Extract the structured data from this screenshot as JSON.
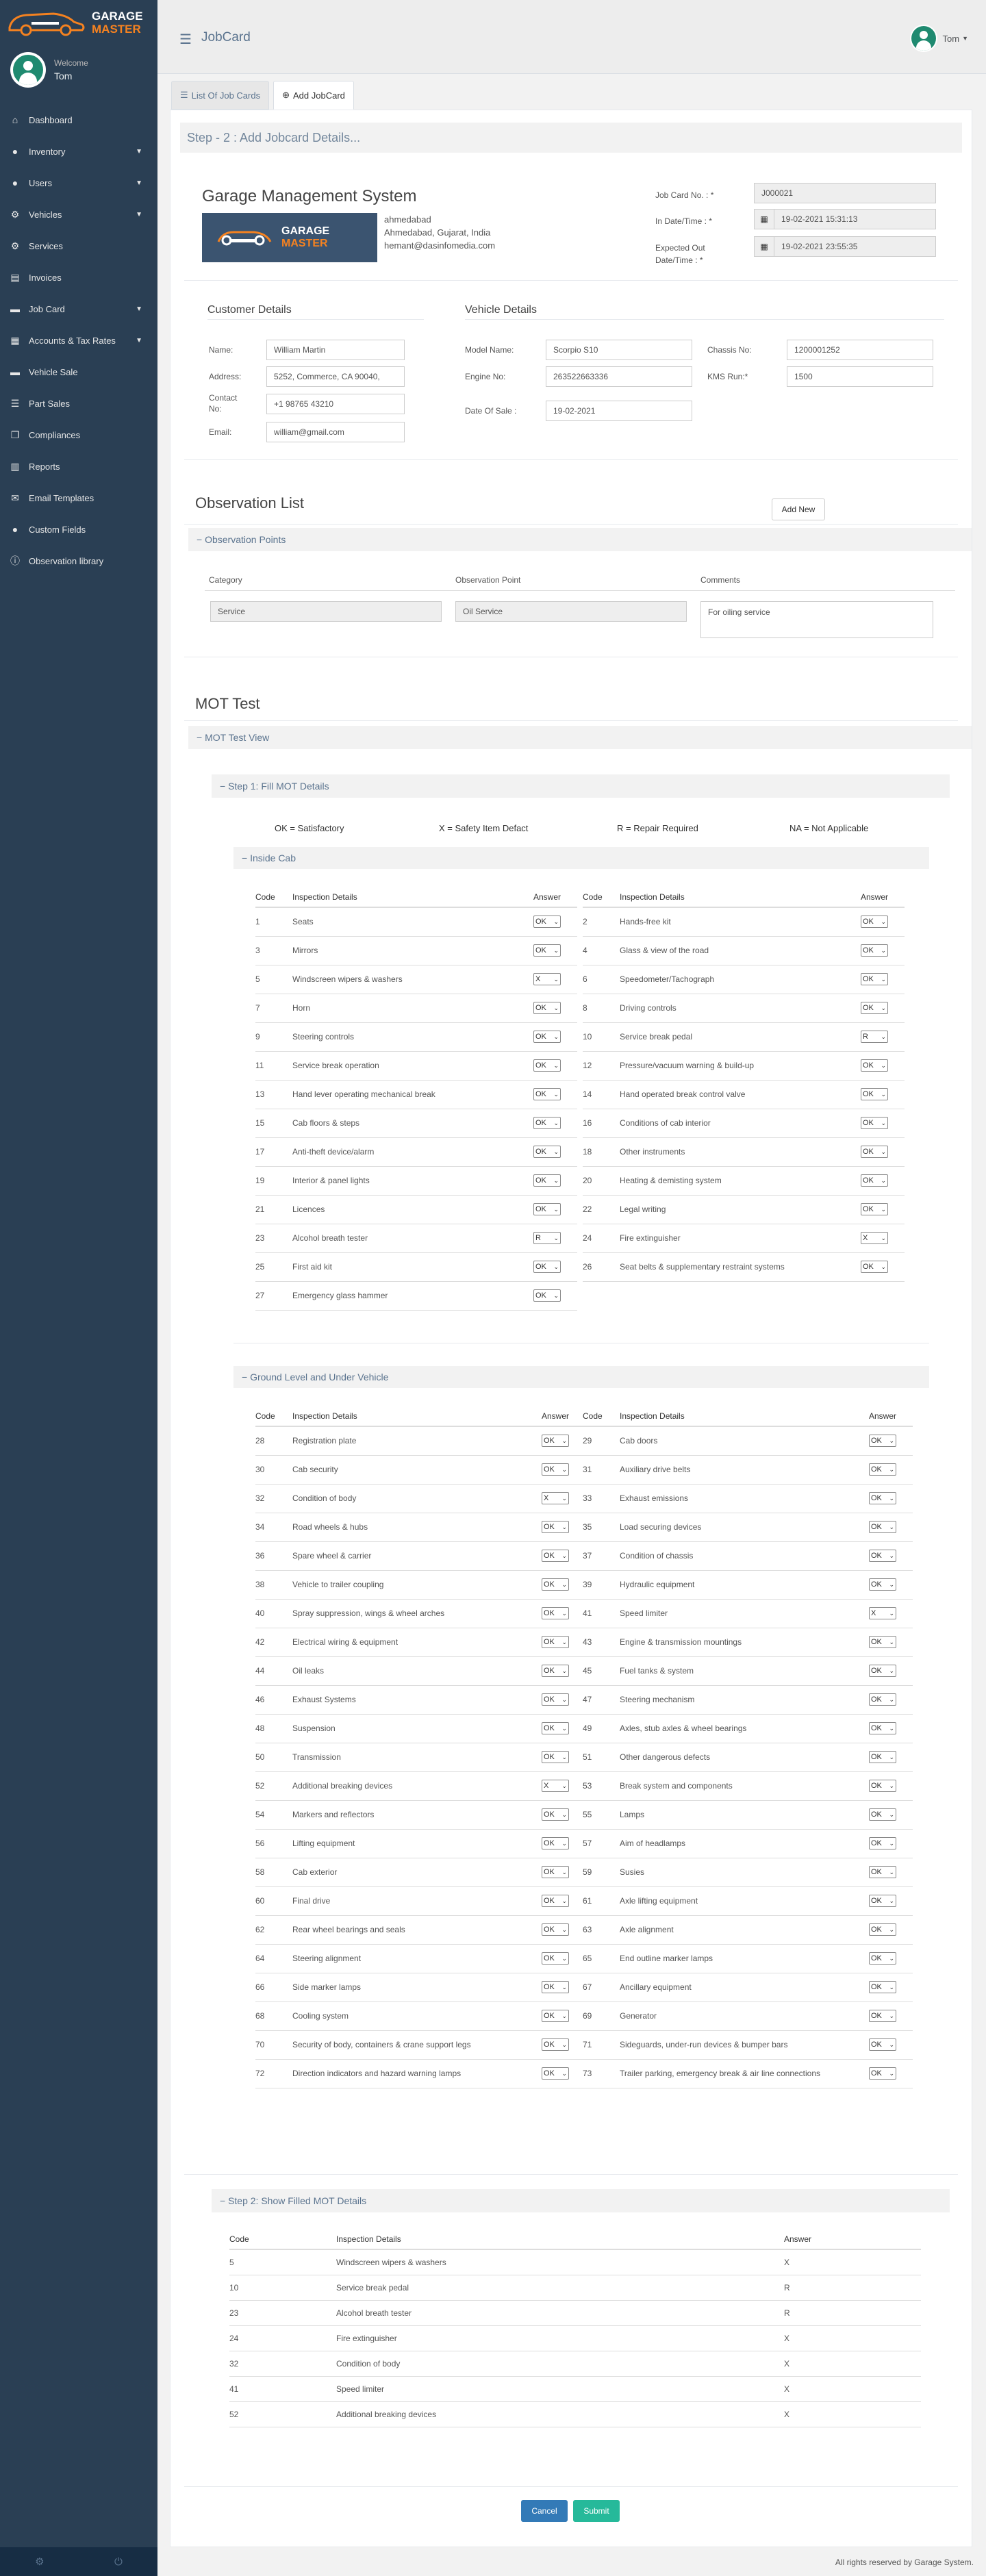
{
  "brand": {
    "line1": "GARAGE",
    "line2": "MASTER",
    "color_accent": "#f58220",
    "sidebar_bg": "#2a3f54"
  },
  "profile": {
    "welcome": "Welcome",
    "name": "Tom"
  },
  "nav": [
    {
      "label": "Dashboard",
      "icon": "home-icon",
      "chev": false
    },
    {
      "label": "Inventory",
      "icon": "user-icon",
      "chev": true
    },
    {
      "label": "Users",
      "icon": "user-icon",
      "chev": true
    },
    {
      "label": "Vehicles",
      "icon": "motorcycle-icon",
      "chev": true
    },
    {
      "label": "Services",
      "icon": "cog-icon",
      "chev": false
    },
    {
      "label": "Invoices",
      "icon": "file-icon",
      "chev": false
    },
    {
      "label": "Job Card",
      "icon": "car-icon",
      "chev": true
    },
    {
      "label": "Accounts & Tax Rates",
      "icon": "bank-icon",
      "chev": true
    },
    {
      "label": "Vehicle Sale",
      "icon": "car-icon",
      "chev": false
    },
    {
      "label": "Part Sales",
      "icon": "list-icon",
      "chev": false
    },
    {
      "label": "Compliances",
      "icon": "copy-icon",
      "chev": false
    },
    {
      "label": "Reports",
      "icon": "chart-icon",
      "chev": false
    },
    {
      "label": "Email Templates",
      "icon": "envelope-icon",
      "chev": false
    },
    {
      "label": "Custom Fields",
      "icon": "user-icon",
      "chev": false
    },
    {
      "label": "Observation library",
      "icon": "info-icon",
      "chev": false
    }
  ],
  "topbar": {
    "title": "JobCard",
    "user": "Tom"
  },
  "tabs": [
    "List Of Job Cards",
    "Add JobCard"
  ],
  "step_title": "Step - 2 : Add Jobcard Details...",
  "company": {
    "name": "Garage Management System",
    "addr1": "ahmedabad",
    "addr2": "Ahmedabad, Gujarat, India",
    "email": "hemant@dasinfomedia.com"
  },
  "job": {
    "no_label": "Job Card No. : *",
    "no": "J000021",
    "in_label": "In Date/Time : *",
    "in": "19-02-2021 15:31:13",
    "out_label": "Expected Out Date/Time : *",
    "out": "19-02-2021 23:55:35"
  },
  "customer": {
    "title": "Customer Details",
    "name_l": "Name:",
    "name": "William Martin",
    "addr_l": "Address:",
    "addr": "5252, Commerce, CA 90040,",
    "contact_l": "Contact No:",
    "contact": "+1 98765 43210",
    "email_l": "Email:",
    "email": "william@gmail.com"
  },
  "vehicle": {
    "title": "Vehicle Details",
    "model_l": "Model Name:",
    "model": "Scorpio S10",
    "engine_l": "Engine No:",
    "engine": "263522663336",
    "sale_l": "Date Of Sale :",
    "sale": "19-02-2021",
    "chassis_l": "Chassis No:",
    "chassis": "1200001252",
    "kms_l": "KMS Run:*",
    "kms": "1500"
  },
  "observation": {
    "title": "Observation List",
    "add": "Add New",
    "points": "Observation Points",
    "col1": "Category",
    "col2": "Observation Point",
    "col3": "Comments",
    "cat": "Service",
    "point": "Oil Service",
    "comment": "For oiling service"
  },
  "mot": {
    "title": "MOT Test",
    "view": "MOT Test View",
    "step1": "Step 1: Fill MOT Details",
    "legend": [
      "OK = Satisfactory",
      "X = Safety Item Defact",
      "R = Repair Required",
      "NA = Not Applicable"
    ],
    "h_code": "Code",
    "h_details": "Inspection Details",
    "h_answer": "Answer"
  },
  "inside_cab": {
    "title": "Inside Cab",
    "rows": [
      [
        "1",
        "Seats",
        "OK",
        "2",
        "Hands-free kit",
        "OK"
      ],
      [
        "3",
        "Mirrors",
        "OK",
        "4",
        "Glass & view of the road",
        "OK"
      ],
      [
        "5",
        "Windscreen wipers & washers",
        "X",
        "6",
        "Speedometer/Tachograph",
        "OK"
      ],
      [
        "7",
        "Horn",
        "OK",
        "8",
        "Driving controls",
        "OK"
      ],
      [
        "9",
        "Steering controls",
        "OK",
        "10",
        "Service break pedal",
        "R"
      ],
      [
        "11",
        "Service break operation",
        "OK",
        "12",
        "Pressure/vacuum warning & build-up",
        "OK"
      ],
      [
        "13",
        "Hand lever operating mechanical break",
        "OK",
        "14",
        "Hand operated break control valve",
        "OK"
      ],
      [
        "15",
        "Cab floors & steps",
        "OK",
        "16",
        "Conditions of cab interior",
        "OK"
      ],
      [
        "17",
        "Anti-theft device/alarm",
        "OK",
        "18",
        "Other instruments",
        "OK"
      ],
      [
        "19",
        "Interior & panel lights",
        "OK",
        "20",
        "Heating & demisting system",
        "OK"
      ],
      [
        "21",
        "Licences",
        "OK",
        "22",
        "Legal writing",
        "OK"
      ],
      [
        "23",
        "Alcohol breath tester",
        "R",
        "24",
        "Fire extinguisher",
        "X"
      ],
      [
        "25",
        "First aid kit",
        "OK",
        "26",
        "Seat belts & supplementary restraint systems",
        "OK"
      ],
      [
        "27",
        "Emergency glass hammer",
        "OK",
        "",
        "",
        ""
      ]
    ]
  },
  "ground": {
    "title": "Ground Level and Under Vehicle",
    "rows": [
      [
        "28",
        "Registration plate",
        "OK",
        "29",
        "Cab doors",
        "OK"
      ],
      [
        "30",
        "Cab security",
        "OK",
        "31",
        "Auxiliary drive belts",
        "OK"
      ],
      [
        "32",
        "Condition of body",
        "X",
        "33",
        "Exhaust emissions",
        "OK"
      ],
      [
        "34",
        "Road wheels & hubs",
        "OK",
        "35",
        "Load securing devices",
        "OK"
      ],
      [
        "36",
        "Spare wheel & carrier",
        "OK",
        "37",
        "Condition of chassis",
        "OK"
      ],
      [
        "38",
        "Vehicle to trailer coupling",
        "OK",
        "39",
        "Hydraulic equipment",
        "OK"
      ],
      [
        "40",
        "Spray suppression, wings & wheel arches",
        "OK",
        "41",
        "Speed limiter",
        "X"
      ],
      [
        "42",
        "Electrical wiring & equipment",
        "OK",
        "43",
        "Engine & transmission mountings",
        "OK"
      ],
      [
        "44",
        "Oil leaks",
        "OK",
        "45",
        "Fuel tanks & system",
        "OK"
      ],
      [
        "46",
        "Exhaust Systems",
        "OK",
        "47",
        "Steering mechanism",
        "OK"
      ],
      [
        "48",
        "Suspension",
        "OK",
        "49",
        "Axles, stub axles & wheel bearings",
        "OK"
      ],
      [
        "50",
        "Transmission",
        "OK",
        "51",
        "Other dangerous defects",
        "OK"
      ],
      [
        "52",
        "Additional breaking devices",
        "X",
        "53",
        "Break system and components",
        "OK"
      ],
      [
        "54",
        "Markers and reflectors",
        "OK",
        "55",
        "Lamps",
        "OK"
      ],
      [
        "56",
        "Lifting equipment",
        "OK",
        "57",
        "Aim of headlamps",
        "OK"
      ],
      [
        "58",
        "Cab exterior",
        "OK",
        "59",
        "Susies",
        "OK"
      ],
      [
        "60",
        "Final drive",
        "OK",
        "61",
        "Axle lifting equipment",
        "OK"
      ],
      [
        "62",
        "Rear wheel bearings and seals",
        "OK",
        "63",
        "Axle alignment",
        "OK"
      ],
      [
        "64",
        "Steering alignment",
        "OK",
        "65",
        "End outline marker lamps",
        "OK"
      ],
      [
        "66",
        "Side marker lamps",
        "OK",
        "67",
        "Ancillary equipment",
        "OK"
      ],
      [
        "68",
        "Cooling system",
        "OK",
        "69",
        "Generator",
        "OK"
      ],
      [
        "70",
        "Security of body, containers & crane support legs",
        "OK",
        "71",
        "Sideguards, under-run devices & bumper bars",
        "OK"
      ],
      [
        "72",
        "Direction indicators and hazard warning lamps",
        "OK",
        "73",
        "Trailer parking, emergency break & air line connections",
        "OK"
      ]
    ]
  },
  "step2": {
    "title": "Step 2: Show Filled MOT Details",
    "rows": [
      [
        "5",
        "Windscreen wipers & washers",
        "X"
      ],
      [
        "10",
        "Service break pedal",
        "R"
      ],
      [
        "23",
        "Alcohol breath tester",
        "R"
      ],
      [
        "24",
        "Fire extinguisher",
        "X"
      ],
      [
        "32",
        "Condition of body",
        "X"
      ],
      [
        "41",
        "Speed limiter",
        "X"
      ],
      [
        "52",
        "Additional breaking devices",
        "X"
      ]
    ]
  },
  "buttons": {
    "cancel": "Cancel",
    "submit": "Submit"
  },
  "footer": "All rights reserved by Garage System."
}
